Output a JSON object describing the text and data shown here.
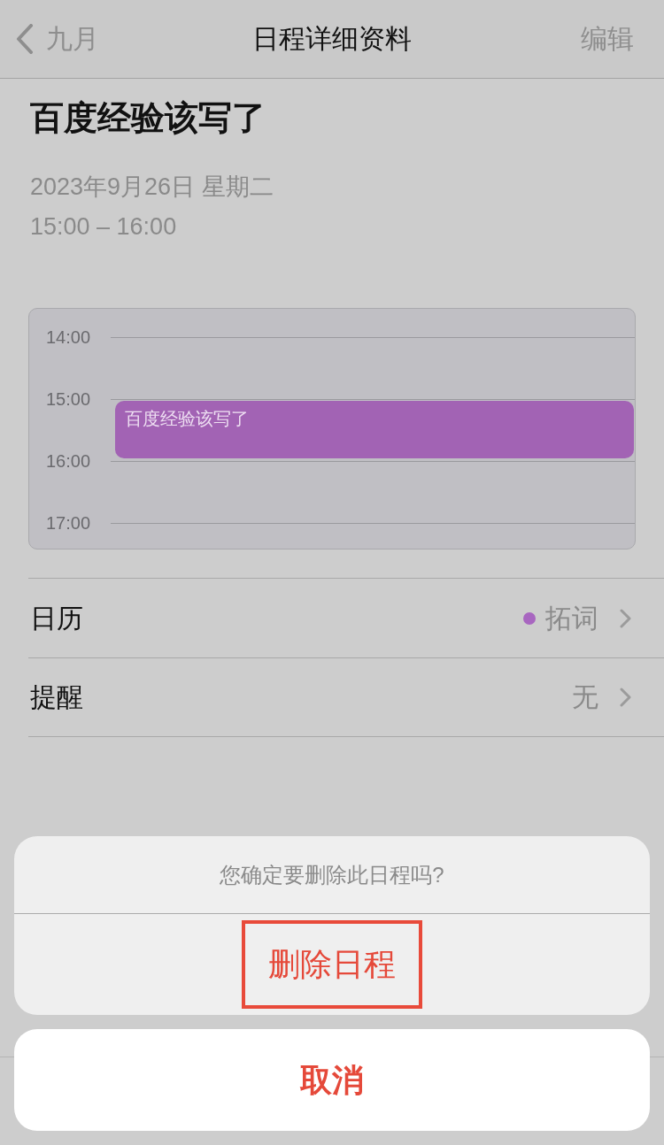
{
  "nav_bar": {
    "back_label": "九月",
    "title": "日程详细资料",
    "action": "编辑"
  },
  "event": {
    "title": "百度经验该写了",
    "date": "2023年9月26日 星期二",
    "time": "15:00 – 16:00"
  },
  "day_preview": {
    "hours": [
      "14:00",
      "15:00",
      "16:00",
      "17:00"
    ],
    "events": [
      {
        "title": "百度经验该写了",
        "color": "#a263b4"
      }
    ]
  },
  "details": [
    {
      "label": "日历",
      "value": "拓词",
      "color": "#a866c0"
    },
    {
      "label": "提醒",
      "value": "无"
    }
  ],
  "action_sheet": {
    "message": "您确定要删除此日程吗?",
    "actions": [
      {
        "label": "删除日程",
        "highlighted": true
      }
    ],
    "cancel": "取消"
  }
}
